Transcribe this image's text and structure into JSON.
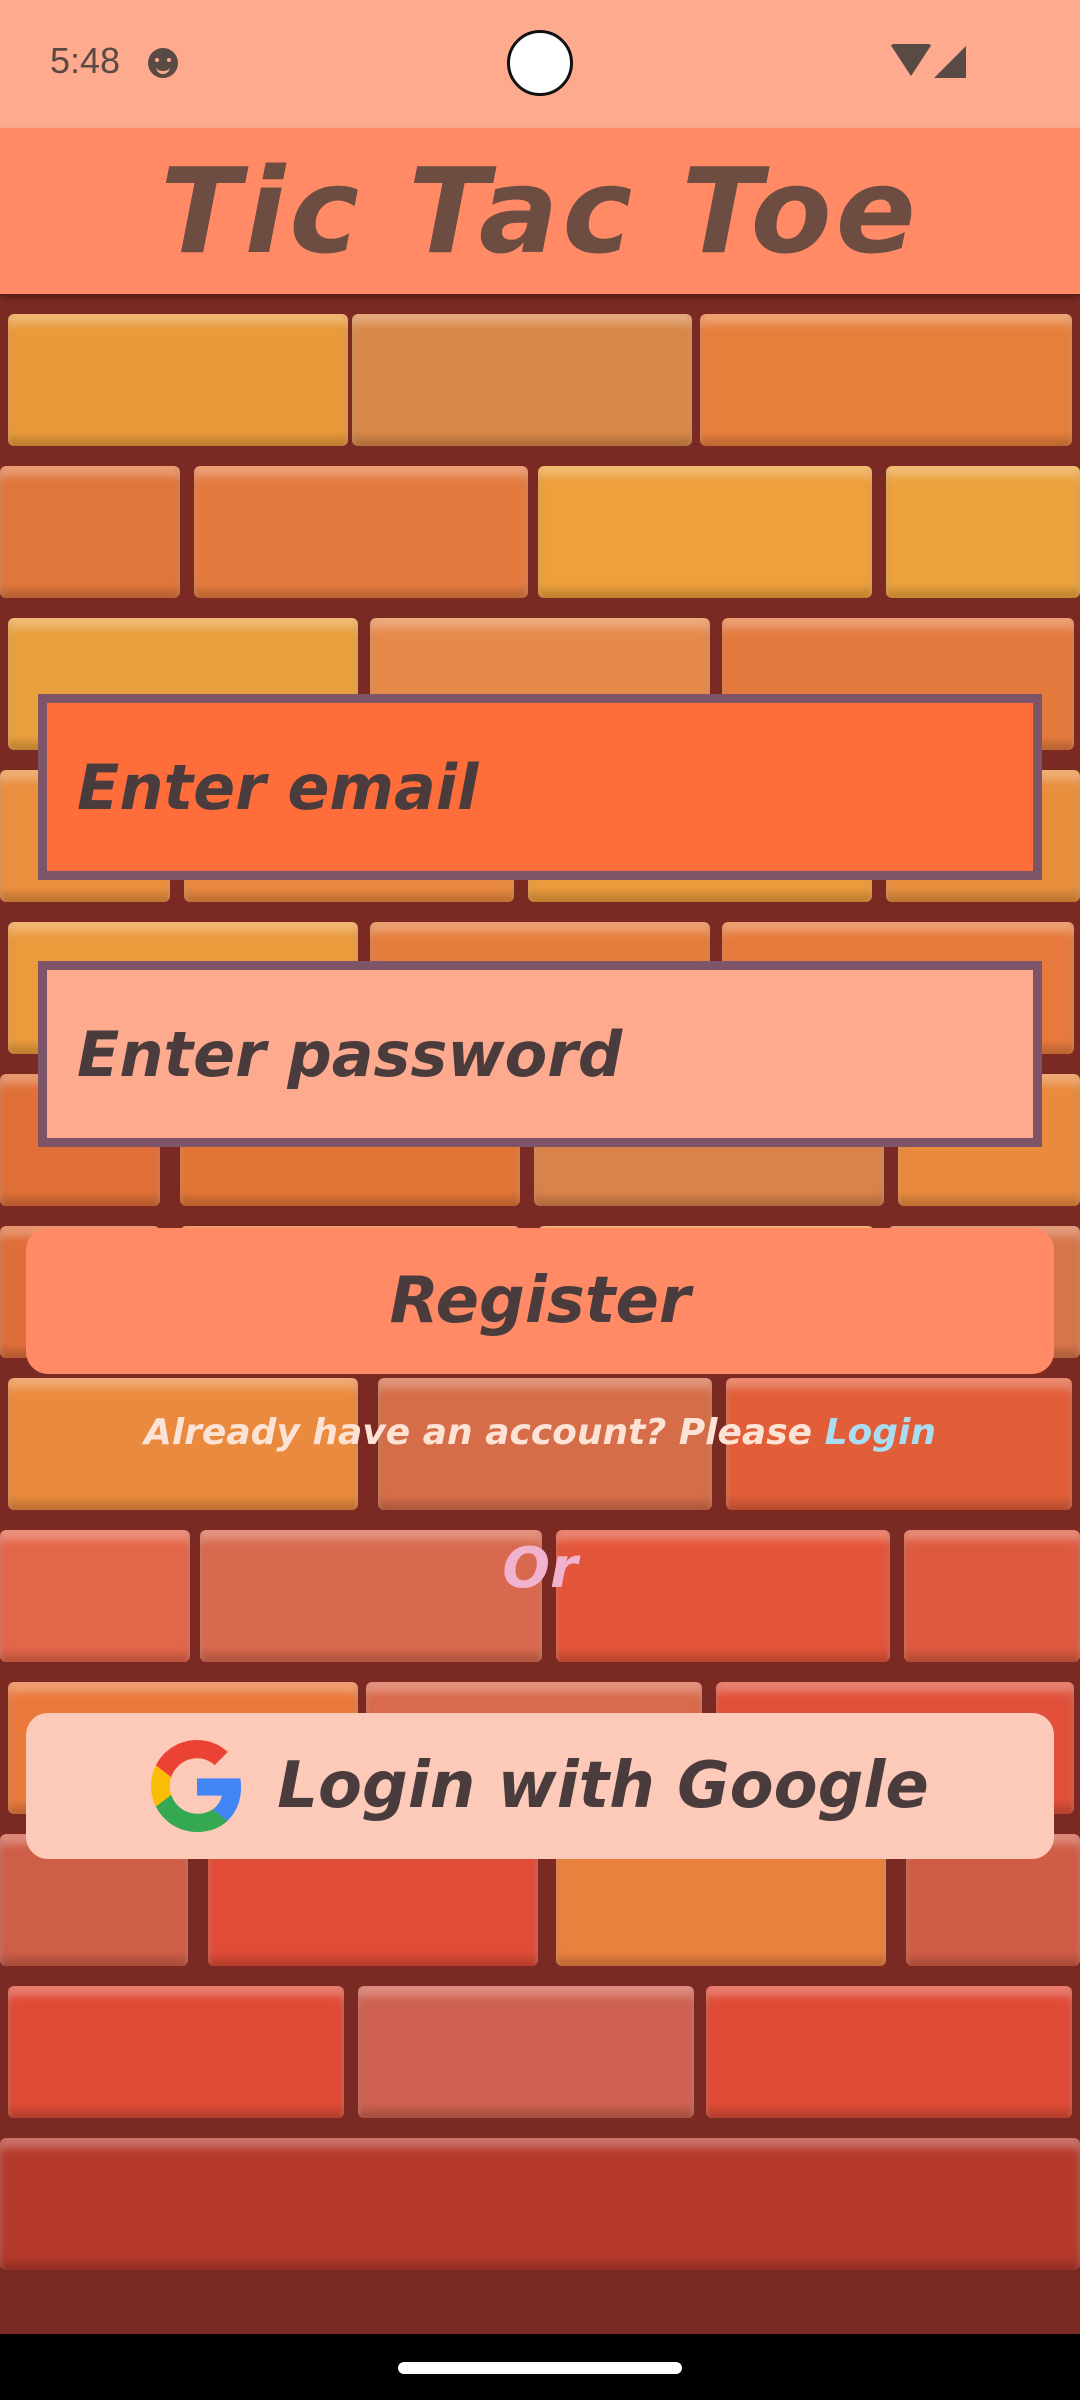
{
  "status_bar": {
    "time": "5:48"
  },
  "app": {
    "title": "Tic Tac Toe"
  },
  "form": {
    "email_placeholder": "Enter email",
    "email_value": "",
    "password_placeholder": "Enter password",
    "password_value": "",
    "register_label": "Register",
    "login_prompt": "Already have an account? Please",
    "login_link": "Login",
    "or_label": "Or",
    "google_label": "Login with Google"
  },
  "colors": {
    "status_bar_bg": "#fdaa8f",
    "title_bar_bg": "#ff8a65",
    "email_field_bg": "#ff6d3b",
    "password_field_bg": "#fdaa8f",
    "field_border": "#7e5568",
    "register_bg": "#ff8a65",
    "google_bg": "#fdc9b8",
    "link": "#a9ddf2"
  },
  "icons": {
    "status": [
      "face-icon",
      "wifi-icon",
      "signal-icon"
    ],
    "google": "google-icon"
  }
}
